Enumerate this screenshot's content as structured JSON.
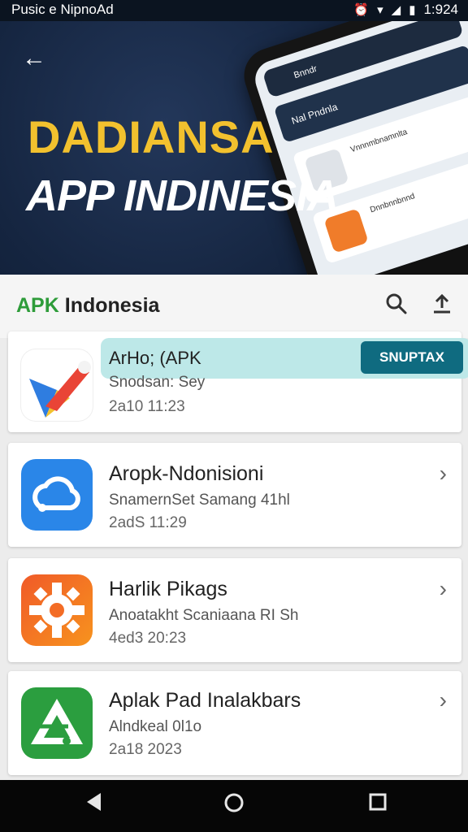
{
  "status_bar": {
    "left_text": "Pusic e NipnoAd",
    "time": "1:924"
  },
  "banner": {
    "title_line1": "DADIANSA",
    "title_line2": "APP INDINESIA",
    "phone_bar": "Bnndr",
    "phone_header": "Nal Pndnla",
    "phone_card1": "Vnnnmbnamnlta",
    "phone_card2": "Dnnbnnbnnd"
  },
  "header": {
    "logo_apk": "APK",
    "logo_text": " Indonesia"
  },
  "list": [
    {
      "name": "ArHo; (APK",
      "sub": "Snodsan: Sey",
      "date": "2a10  11:23",
      "action": "SNUPTAX"
    },
    {
      "name": "Aropk-Ndonisioni",
      "sub": "SnamernSet Samang 41hl",
      "date": "2adS  11:29"
    },
    {
      "name": "Harlik Pikags",
      "sub": "Anoatakht Scaniaana RI Sh",
      "date": "4ed3  20:23"
    },
    {
      "name": "Aplak Pad Inalakbars",
      "sub": "Alndkeal 0l1o",
      "date": "2a18  2023"
    }
  ],
  "colors": {
    "accent_green": "#2e9c3a",
    "action_teal": "#0f6b80",
    "banner_yellow": "#f2c12e"
  }
}
